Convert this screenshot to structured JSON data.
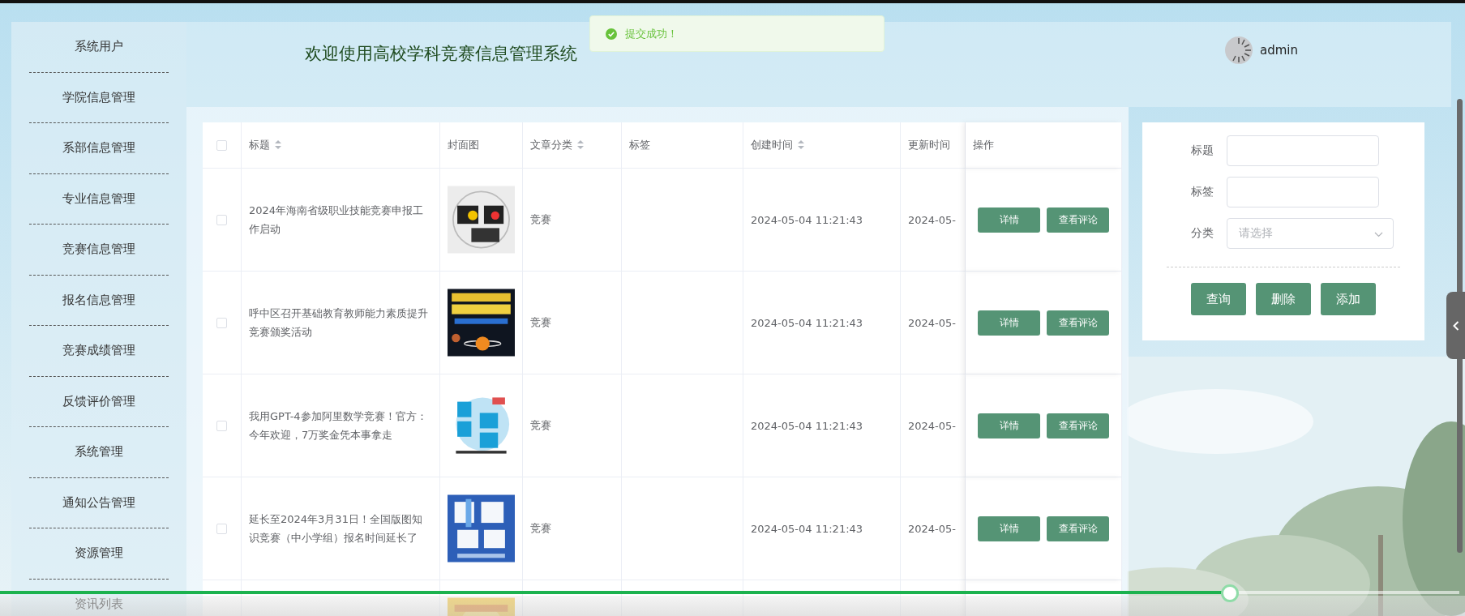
{
  "toast": {
    "text": "提交成功！"
  },
  "sidebar": {
    "items": [
      {
        "label": "系统用户"
      },
      {
        "label": "学院信息管理"
      },
      {
        "label": "系部信息管理"
      },
      {
        "label": "专业信息管理"
      },
      {
        "label": "竞赛信息管理"
      },
      {
        "label": "报名信息管理"
      },
      {
        "label": "竞赛成绩管理"
      },
      {
        "label": "反馈评价管理"
      },
      {
        "label": "系统管理"
      },
      {
        "label": "通知公告管理"
      },
      {
        "label": "资源管理"
      },
      {
        "label": "资讯列表"
      }
    ]
  },
  "header": {
    "title": "欢迎使用高校学科竞赛信息管理系统",
    "user": "admin"
  },
  "table": {
    "columns": [
      {
        "kind": "checkbox",
        "checked": false
      },
      {
        "kind": "text",
        "label": "标题",
        "sortable": true
      },
      {
        "kind": "text",
        "label": "封面图",
        "sortable": false
      },
      {
        "kind": "text",
        "label": "文章分类",
        "sortable": true
      },
      {
        "kind": "text",
        "label": "标签",
        "sortable": false
      },
      {
        "kind": "text",
        "label": "创建时间",
        "sortable": true
      },
      {
        "kind": "text",
        "label": "更新时间",
        "sortable": false
      },
      {
        "kind": "text",
        "label": "操作",
        "sortable": false
      }
    ],
    "rows": [
      {
        "checked": false,
        "title": "2024年海南省级职业技能竞赛申报工作启动",
        "cover": {
          "kind": "picture"
        },
        "category": "竞赛",
        "created": "2024-05-04 11:21:43",
        "updated": "2024-05-",
        "actions": [
          "详情",
          "查看评论"
        ]
      },
      {
        "checked": false,
        "title": "呼中区召开基础教育教师能力素质提升竞赛颁奖活动",
        "cover": {
          "kind": "picture"
        },
        "category": "竞赛",
        "created": "2024-05-04 11:21:43",
        "updated": "2024-05-",
        "actions": [
          "详情",
          "查看评论"
        ]
      },
      {
        "checked": false,
        "title": "我用GPT-4参加阿里数学竞赛！官方：今年欢迎，7万奖金凭本事拿走",
        "cover": {
          "kind": "picture"
        },
        "category": "竞赛",
        "created": "2024-05-04 11:21:43",
        "updated": "2024-05-",
        "actions": [
          "详情",
          "查看评论"
        ]
      },
      {
        "checked": false,
        "title": "延长至2024年3月31日！全国版图知识竞赛（中小学组）报名时间延长了",
        "cover": {
          "kind": "picture"
        },
        "category": "竞赛",
        "created": "2024-05-04 11:21:43",
        "updated": "2024-05-",
        "actions": [
          "详情",
          "查看评论"
        ]
      },
      {
        "cover": {
          "kind": "picture"
        }
      }
    ]
  },
  "search": {
    "fields": [
      {
        "kind": "text",
        "label": "标题"
      },
      {
        "kind": "text",
        "label": "标签"
      },
      {
        "kind": "select",
        "label": "分类",
        "placeholder": "请选择"
      }
    ],
    "buttons": [
      {
        "label": "查询"
      },
      {
        "label": "删除"
      },
      {
        "label": "添加"
      }
    ]
  },
  "player": {
    "level": 0.843
  }
}
